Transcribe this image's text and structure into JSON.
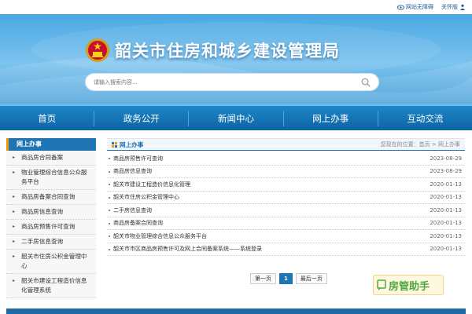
{
  "topbar": {
    "accessibility_label": "网站无障碍",
    "elder_label": "关怀版"
  },
  "header": {
    "site_title": "韶关市住房和城乡建设管理局",
    "search_placeholder": "请输入搜索内容..."
  },
  "nav": {
    "items": [
      "首页",
      "政务公开",
      "新闻中心",
      "网上办事",
      "互动交流"
    ]
  },
  "sidebar": {
    "title": "网上办事",
    "items": [
      "商品房合同备案",
      "物业管理综合信息公众服务平台",
      "商品房备案合同查询",
      "商品房信息查询",
      "商品房预售许可查询",
      "二手房信息查询",
      "韶关市住房公积金管理中心",
      "韶关市建设工程造价信息化管理系统"
    ]
  },
  "main": {
    "title": "网上办事",
    "breadcrumb": "您现在的位置：首页 > 网上办事",
    "rows": [
      {
        "title": "商品房预售许可查询",
        "date": "2023-08-29"
      },
      {
        "title": "商品房信息查询",
        "date": "2023-08-29"
      },
      {
        "title": "韶关市建设工程造价信息化管理",
        "date": "2020-01-13"
      },
      {
        "title": "韶关市住房公积金管理中心",
        "date": "2020-01-13"
      },
      {
        "title": "二手房信息查询",
        "date": "2020-01-13"
      },
      {
        "title": "商品房备案合同查询",
        "date": "2020-01-13"
      },
      {
        "title": "韶关市物业管理综合信息公众服务平台",
        "date": "2020-01-13"
      },
      {
        "title": "韶关市市区商品房预售许可及网上合同备案系统——系统登录",
        "date": "2020-01-13"
      }
    ]
  },
  "pager": {
    "first": "第一页",
    "current": "1",
    "last": "最后一页"
  },
  "badge": {
    "text": "房管助手"
  },
  "colors": {
    "nav_blue": "#0d64a3",
    "accent_orange": "#f39800",
    "badge_green": "#4ea83d"
  }
}
